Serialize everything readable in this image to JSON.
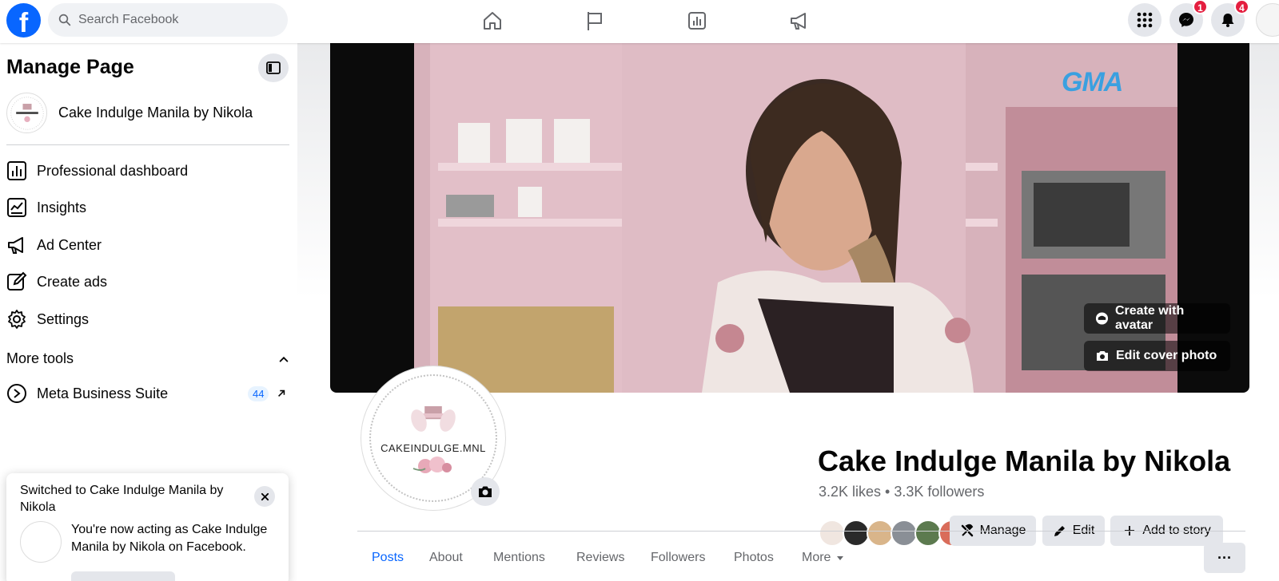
{
  "topbar": {
    "logo": "f",
    "search_placeholder": "Search Facebook",
    "messenger_badge": "1",
    "notifications_badge": "4"
  },
  "sidebar": {
    "title": "Manage Page",
    "page_name": "Cake Indulge Manila by Nikola",
    "items": [
      {
        "label": "Professional dashboard",
        "icon": "dashboard-icon"
      },
      {
        "label": "Insights",
        "icon": "insights-icon"
      },
      {
        "label": "Ad Center",
        "icon": "megaphone-icon"
      },
      {
        "label": "Create ads",
        "icon": "pencil-icon"
      },
      {
        "label": "Settings",
        "icon": "gear-icon"
      }
    ],
    "more_tools": "More tools",
    "meta_business_suite": "Meta Business Suite",
    "meta_badge": "44"
  },
  "toast": {
    "title": "Switched to Cake Indulge Manila by Nikola",
    "body": "You're now acting as Cake Indulge Manila by Nikola on Facebook."
  },
  "cover": {
    "watermark": "GMA",
    "create_avatar": "Create with avatar",
    "edit_cover": "Edit cover photo"
  },
  "profile": {
    "logo_text": "CAKEINDULGE.MNL",
    "name": "Cake Indulge Manila by Nikola",
    "stats": "3.2K likes • 3.3K followers",
    "buttons": {
      "manage": "Manage",
      "edit": "Edit",
      "add_story": "Add to story"
    }
  },
  "tabs": [
    "Posts",
    "About",
    "Mentions",
    "Reviews",
    "Followers",
    "Photos",
    "More"
  ],
  "more_menu": "···",
  "colors": {
    "brand": "#0866ff",
    "badge_red": "#e41e3f",
    "button_gray": "#e4e6eb"
  }
}
